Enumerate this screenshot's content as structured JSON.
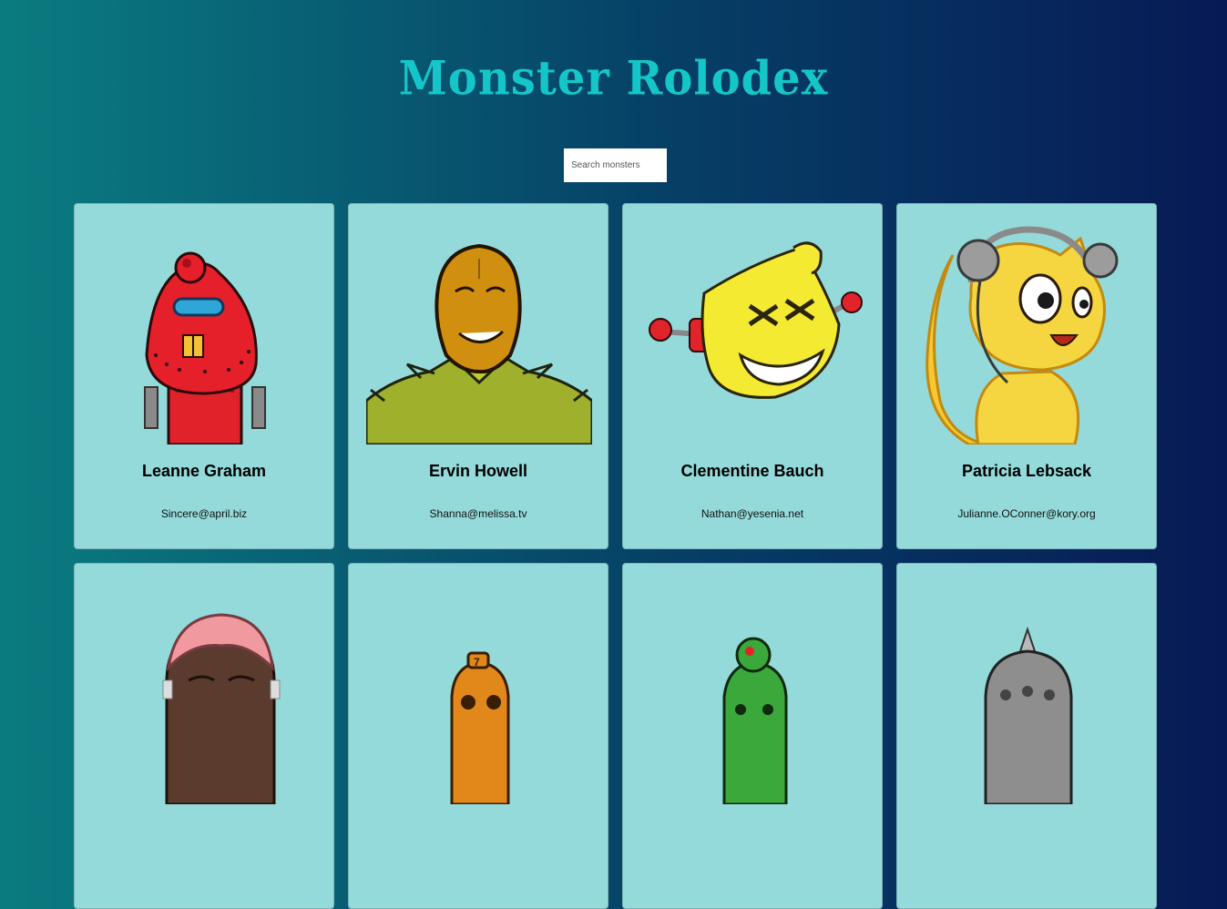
{
  "header": {
    "title": "Monster Rolodex"
  },
  "search": {
    "placeholder": "Search monsters"
  },
  "monsters": [
    {
      "name": "Leanne Graham",
      "email": "Sincere@april.biz",
      "avatar": "red-robot"
    },
    {
      "name": "Ervin Howell",
      "email": "Shanna@melissa.tv",
      "avatar": "mustard-brute"
    },
    {
      "name": "Clementine Bauch",
      "email": "Nathan@yesenia.net",
      "avatar": "yellow-grin"
    },
    {
      "name": "Patricia Lebsack",
      "email": "Julianne.OConner@kory.org",
      "avatar": "tabby-cat"
    },
    {
      "name": "",
      "email": "",
      "avatar": "pink-hair-brute"
    },
    {
      "name": "",
      "email": "",
      "avatar": "orange-robot"
    },
    {
      "name": "",
      "email": "",
      "avatar": "green-robot"
    },
    {
      "name": "",
      "email": "",
      "avatar": "spiked-helmet-robot"
    }
  ],
  "colors": {
    "card_background": "#95dada",
    "title": "#14c6c8",
    "gradient_left": "#0a7c80",
    "gradient_right": "#071a55"
  }
}
